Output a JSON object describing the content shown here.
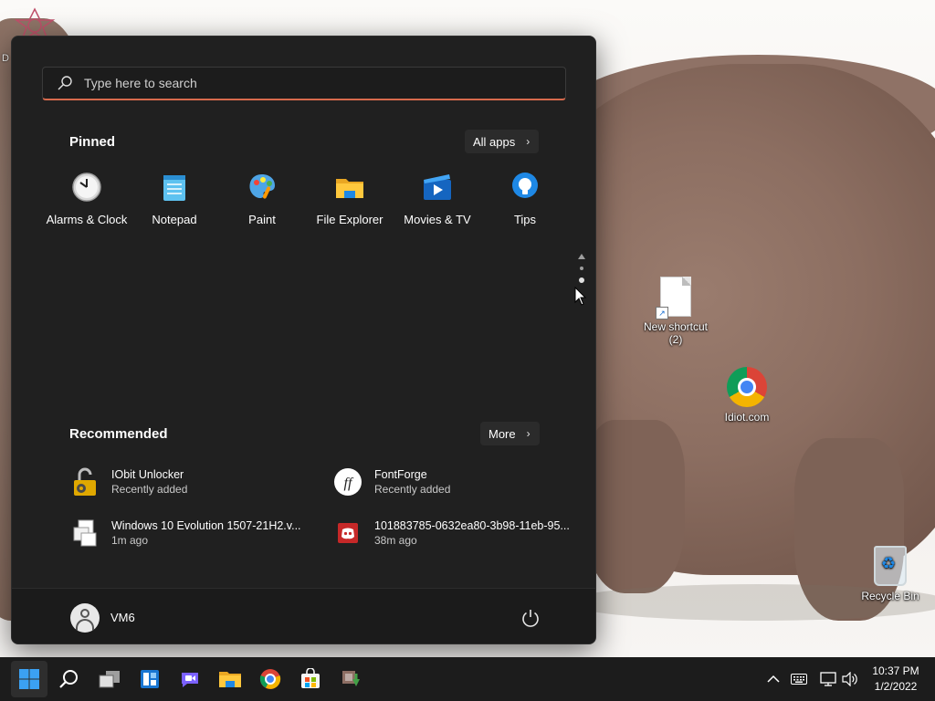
{
  "desktop": {
    "corner_label": "D",
    "icons": [
      {
        "label": "New shortcut (2)",
        "icon": "document-icon"
      },
      {
        "label": "Idiot.com",
        "icon": "chrome-icon"
      },
      {
        "label": "Recycle Bin",
        "icon": "recycle-bin-icon"
      }
    ]
  },
  "start_menu": {
    "search_placeholder": "Type here to search",
    "pinned_title": "Pinned",
    "all_apps_label": "All apps",
    "pinned_apps": [
      {
        "label": "Alarms & Clock",
        "icon": "clock-icon"
      },
      {
        "label": "Notepad",
        "icon": "notepad-icon"
      },
      {
        "label": "Paint",
        "icon": "paint-icon"
      },
      {
        "label": "File Explorer",
        "icon": "folder-icon"
      },
      {
        "label": "Movies & TV",
        "icon": "movies-icon"
      },
      {
        "label": "Tips",
        "icon": "lightbulb-icon"
      }
    ],
    "recommended_title": "Recommended",
    "more_label": "More",
    "recommended": [
      {
        "name": "IObit Unlocker",
        "sub": "Recently added",
        "icon": "unlock-icon"
      },
      {
        "name": "FontForge",
        "sub": "Recently added",
        "icon": "fontforge-icon"
      },
      {
        "name": "Windows 10 Evolution 1507-21H2.v...",
        "sub": "1m ago",
        "icon": "file-icon"
      },
      {
        "name": "101883785-0632ea80-3b98-11eb-95...",
        "sub": "38m ago",
        "icon": "discord-icon"
      }
    ],
    "user_name": "VM6"
  },
  "taskbar": {
    "apps": [
      "windows-start-icon",
      "search-icon",
      "task-view-icon",
      "widgets-icon",
      "chat-icon",
      "file-explorer-icon",
      "chrome-icon",
      "store-icon",
      "app-icon"
    ],
    "clock_time": "10:37 PM",
    "clock_date": "1/2/2022"
  },
  "colors": {
    "accent_underline": "#d76a4d",
    "menu_bg": "#202020",
    "taskbar_bg": "#1c1c1c",
    "windows_blue": "#0078d4"
  }
}
